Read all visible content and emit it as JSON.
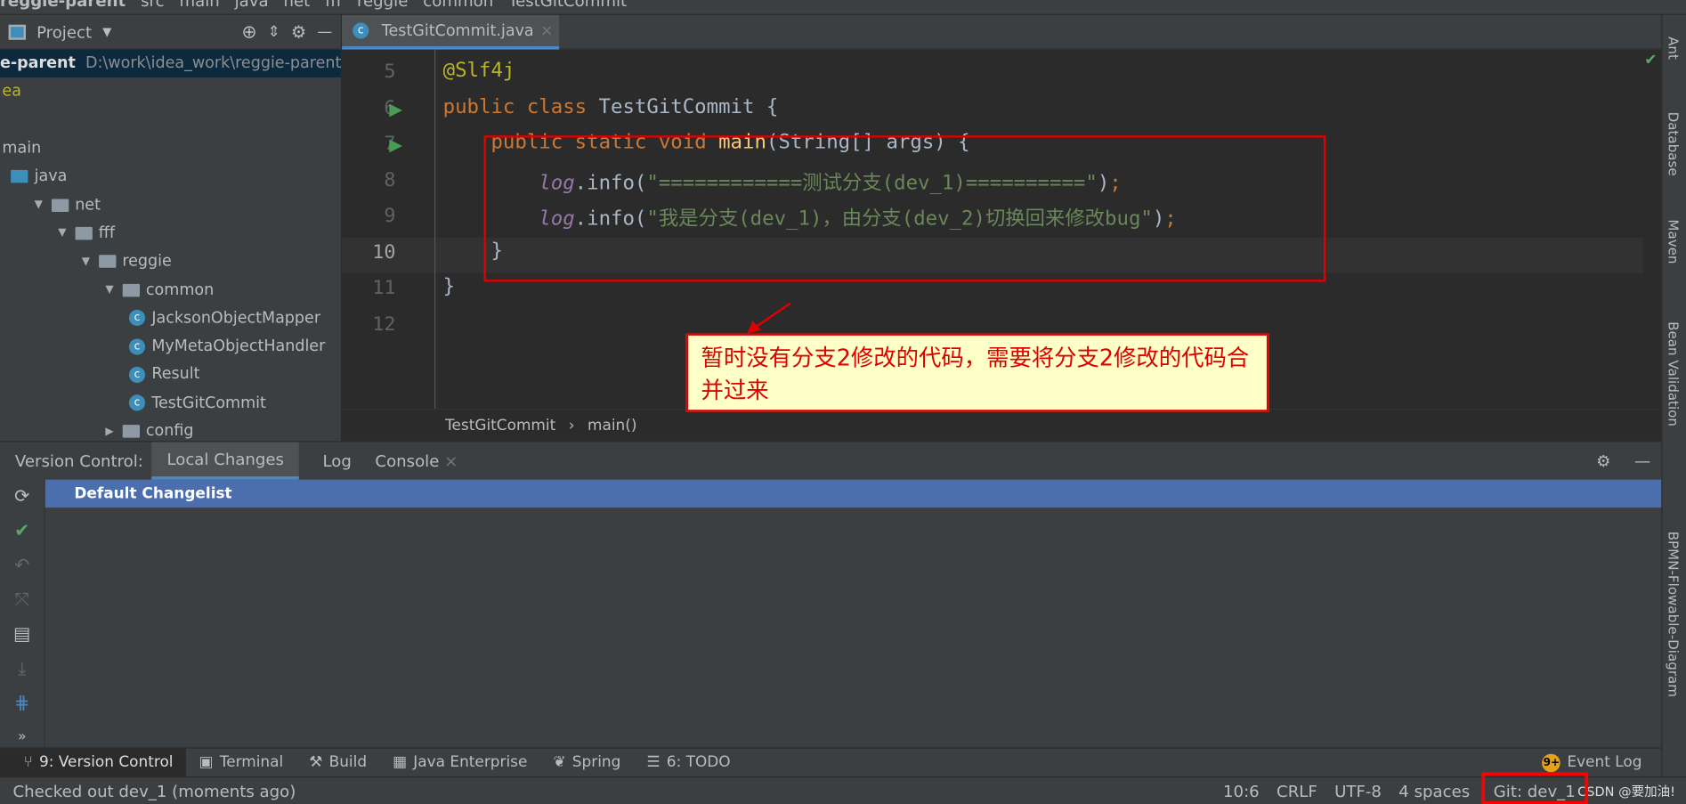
{
  "breadcrumb": [
    "reggie-parent",
    "src",
    "main",
    "java",
    "net",
    "fff",
    "reggie",
    "common",
    "TestGitCommit"
  ],
  "project": {
    "title": "Project",
    "root_name": "e-parent",
    "root_path": "D:\\work\\idea_work\\reggie-parent",
    "items": [
      {
        "label": "ea",
        "type": "text",
        "depth": 0
      },
      {
        "label": "",
        "type": "blank",
        "depth": 0
      },
      {
        "label": "main",
        "type": "text",
        "depth": 0
      },
      {
        "label": "java",
        "type": "folder",
        "depth": 0
      },
      {
        "label": "net",
        "type": "package",
        "depth": 1
      },
      {
        "label": "fff",
        "type": "package",
        "depth": 2
      },
      {
        "label": "reggie",
        "type": "package",
        "depth": 3
      },
      {
        "label": "common",
        "type": "package",
        "depth": 4
      },
      {
        "label": "JacksonObjectMapper",
        "type": "class",
        "depth": 5
      },
      {
        "label": "MyMetaObjectHandler",
        "type": "class",
        "depth": 5
      },
      {
        "label": "Result",
        "type": "class",
        "depth": 5
      },
      {
        "label": "TestGitCommit",
        "type": "class",
        "depth": 5
      },
      {
        "label": "config",
        "type": "package-collapsed",
        "depth": 4
      }
    ]
  },
  "editor": {
    "tab": "TestGitCommit.java",
    "lines": [
      {
        "n": "5",
        "html": "<span class='ann'>@Slf4j</span>"
      },
      {
        "n": "6",
        "html": "<span class='kw'>public class </span>TestGitCommit {"
      },
      {
        "n": "7",
        "html": "    <span class='kw'>public static void </span><span class='fn'>main</span>(String[] args) {"
      },
      {
        "n": "8",
        "html": "        <span class='log'>log</span>.info(<span class='str'>\"============测试分支(dev_1)==========\"</span>)<span class='kw'>;</span>"
      },
      {
        "n": "9",
        "html": "        <span class='log'>log</span>.info(<span class='str'>\"我是分支(dev_1)，由分支(dev_2)切换回来修改bug\"</span>)<span class='kw'>;</span>"
      },
      {
        "n": "10",
        "html": "    }"
      },
      {
        "n": "11",
        "html": "}"
      },
      {
        "n": "12",
        "html": ""
      }
    ],
    "crumbs": [
      "TestGitCommit",
      "main()"
    ]
  },
  "annotation": "暂时没有分支2修改的代码，需要将分支2修改的代码合并过来",
  "right_tools": [
    "Ant",
    "Database",
    "Maven",
    "Bean Validation",
    "BPMN-Flowable-Diagram"
  ],
  "bottom": {
    "label": "Version Control:",
    "tabs": [
      "Local Changes",
      "Log",
      "Console"
    ],
    "changelist": "Default Changelist"
  },
  "toolwindows": [
    "9: Version Control",
    "Terminal",
    "Build",
    "Java Enterprise",
    "Spring",
    "6: TODO"
  ],
  "event_log": {
    "badge": "9+",
    "label": "Event Log"
  },
  "status": {
    "message": "Checked out dev_1 (moments ago)",
    "pos": "10:6",
    "eol": "CRLF",
    "enc": "UTF-8",
    "indent": "4 spaces",
    "git": "Git: dev_1",
    "watermark": "CSDN @要加油!"
  },
  "colors": {
    "accent": "#4b6eaf",
    "highlight": "#e00000",
    "note_bg": "#ffffc8"
  }
}
